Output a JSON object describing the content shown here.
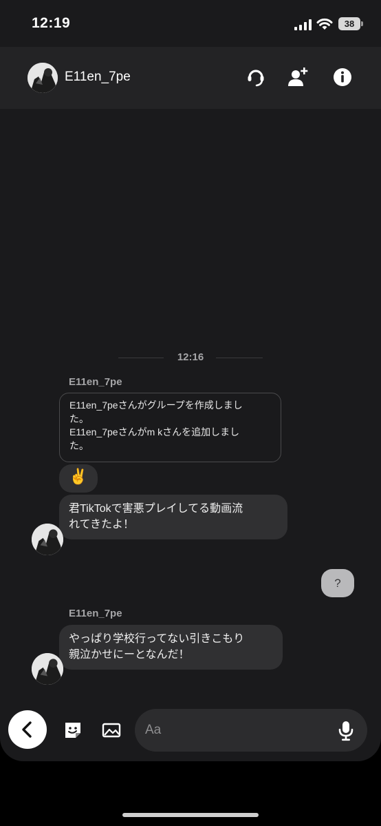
{
  "status_bar": {
    "time": "12:19",
    "battery": "38",
    "icons": [
      "signal-icon",
      "wifi-icon",
      "battery-icon"
    ]
  },
  "header": {
    "title": "E11en_7pe",
    "icons": [
      "phone-call-icon",
      "add-member-icon",
      "info-icon"
    ]
  },
  "conversation": {
    "timestamp": "12:16",
    "sender_1": "E11en_7pe",
    "system_lines": [
      "E11en_7peさんがグループを作成しまし",
      "た。",
      "E11en_7peさんがm kさんを追加しまし",
      "た。"
    ],
    "emoji_message": "✌️",
    "message_1_lines": [
      "君TikTokで害悪プレイしてる動画流",
      "れてきたよ！"
    ],
    "my_message": "?",
    "sender_2": "E11en_7pe",
    "message_2_lines": [
      "やっぱり学校行ってない引きこもり",
      "親泣かせにーとなんだ！"
    ]
  },
  "composer": {
    "placeholder": "Aa",
    "icons": [
      "back-chevron-icon",
      "sticker-icon",
      "image-icon",
      "microphone-icon"
    ]
  },
  "colors": {
    "background": "#1a1a1c",
    "header": "#232325",
    "bubble": "#303032",
    "my_bubble": "#b9b9bb"
  }
}
